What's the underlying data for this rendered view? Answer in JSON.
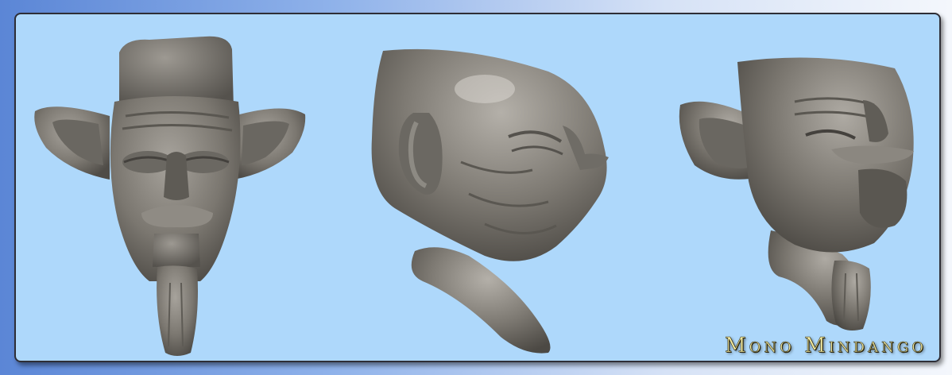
{
  "title": "Mono Mindango",
  "colors": {
    "background_panel": "#aed8fb",
    "sculpt": "#7d7a74",
    "title_text": "#f4eca2",
    "frame_border": "#2e2e36"
  },
  "views": [
    {
      "name": "front-view"
    },
    {
      "name": "side-view"
    },
    {
      "name": "three-quarter-view"
    }
  ]
}
